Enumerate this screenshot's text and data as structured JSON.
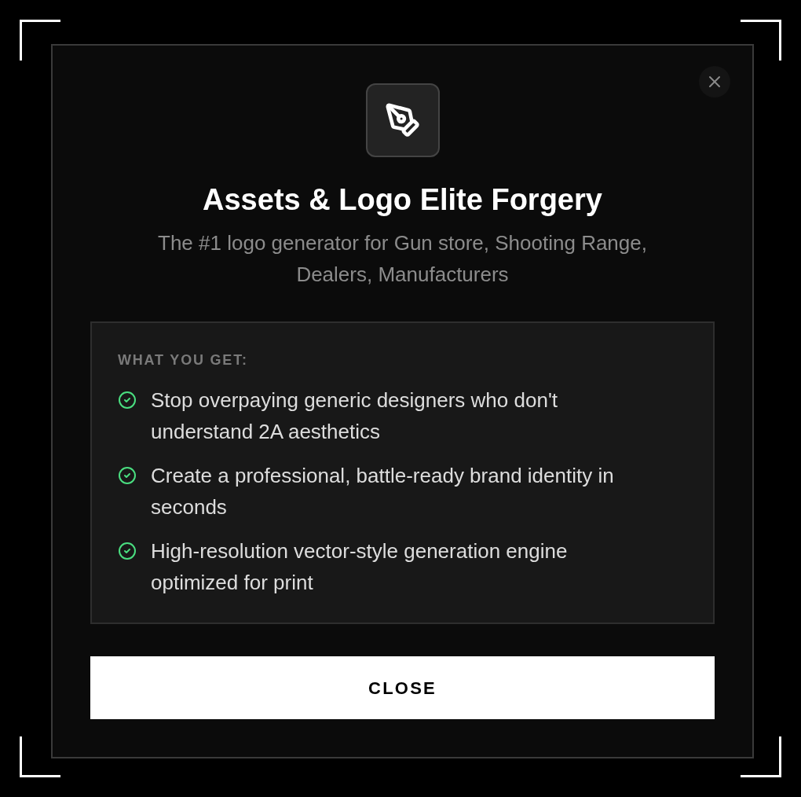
{
  "dialog": {
    "title": "Assets & Logo Elite Forgery",
    "subtitle": "The #1 logo generator for Gun store, Shooting Range, Dealers, Manufacturers",
    "features": {
      "heading": "WHAT YOU GET:",
      "items": [
        "Stop overpaying generic designers who don't understand 2A aesthetics",
        "Create a professional, battle-ready brand identity in seconds",
        "High-resolution vector-style generation engine optimized for print"
      ]
    },
    "button": "CLOSE"
  }
}
